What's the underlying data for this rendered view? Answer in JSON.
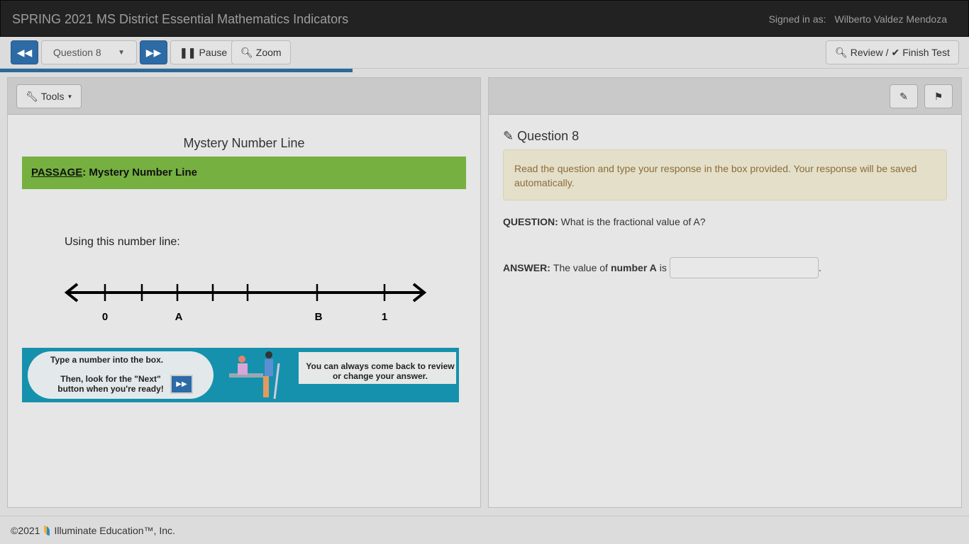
{
  "header": {
    "title": "SPRING 2021 MS District Essential Mathematics Indicators",
    "signed_in_label": "Signed in as:",
    "user_name": "Wilberto Valdez Mendoza"
  },
  "toolbar": {
    "question_select": "Question 8",
    "pause_label": "Pause",
    "zoom_label": "Zoom",
    "review_label": "Review /",
    "finish_label": "Finish Test"
  },
  "progress": {
    "percent": 36.4
  },
  "left_panel": {
    "tools_label": "Tools",
    "passage_title": "Mystery Number Line",
    "passage_banner_label": "PASSAGE",
    "passage_banner_title": ": Mystery Number Line",
    "prompt": "Using this number line:",
    "number_line_labels": [
      "0",
      "A",
      "B",
      "1"
    ],
    "banner": {
      "line1": "Type a number into the box.",
      "line2a": "Then, look for the \"",
      "line2b": "Next",
      "line2c": "\"",
      "line3": "button when you're ready!",
      "right_text": "You can always come back to review or change your answer."
    }
  },
  "right_panel": {
    "question_heading": "Question 8",
    "instructions": "Read the question and type your response in the box provided. Your response will be saved automatically.",
    "question_label": "QUESTION:",
    "question_text": "What is the fractional value of A?",
    "answer_label": "ANSWER:",
    "answer_text_a": "The value of",
    "answer_text_bold": "number A",
    "answer_text_b": "is",
    "answer_value": "",
    "answer_suffix": "."
  },
  "footer": {
    "copyright": "©2021",
    "company": "Illuminate Education™, Inc."
  }
}
